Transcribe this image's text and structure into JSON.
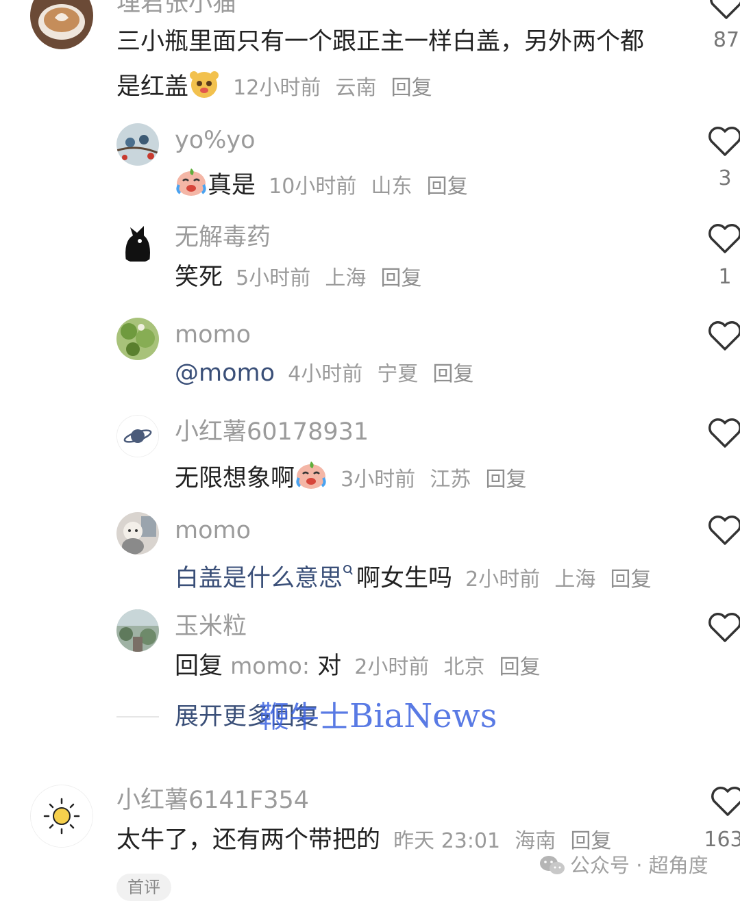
{
  "comments": [
    {
      "username": "埋君张小猫",
      "text_line1": "三小瓶里面只有一个跟正主一样白盖，另外两个都",
      "text_line2": "是红盖",
      "emoji": "bear-face-emoji",
      "time": "12小时前",
      "location": "云南",
      "reply": "回复",
      "likes": "87"
    },
    {
      "username": "yo%yo",
      "emoji": "crying-laugh-emoji",
      "text": "真是",
      "time": "10小时前",
      "location": "山东",
      "reply": "回复",
      "likes": "3"
    },
    {
      "username": "无解毒药",
      "text": "笑死",
      "time": "5小时前",
      "location": "上海",
      "reply": "回复",
      "likes": "1"
    },
    {
      "username": "momo",
      "text": "@momo",
      "time": "4小时前",
      "location": "宁夏",
      "reply": "回复",
      "likes": ""
    },
    {
      "username": "小红薯60178931",
      "text": "无限想象啊",
      "emoji": "crying-laugh-emoji",
      "time": "3小时前",
      "location": "江苏",
      "reply": "回复",
      "likes": ""
    },
    {
      "username": "momo",
      "link_text": "白盖是什么意思",
      "text": "啊女生吗",
      "time": "2小时前",
      "location": "上海",
      "reply": "回复",
      "likes": ""
    },
    {
      "username": "玉米粒",
      "reply_prefix": "回复",
      "reply_target": "momo:",
      "text": "对",
      "time": "2小时前",
      "location": "北京",
      "reply": "回复",
      "likes": ""
    },
    {
      "username": "小红薯6141F354",
      "text": "太牛了，还有两个带把的",
      "time": "昨天 23:01",
      "location": "海南",
      "reply": "回复",
      "likes": "163",
      "badge": "首评"
    }
  ],
  "expand_more": "展开更多回复",
  "watermark": "BiaNews",
  "watermark_cn": "鞭牛士",
  "footer": {
    "label": "公众号 · 超角度"
  },
  "colors": {
    "username": "#9b9b9b",
    "text": "#222222",
    "meta": "#9a9a9a",
    "link": "#3a4f78",
    "watermark": "#3d63e0"
  }
}
